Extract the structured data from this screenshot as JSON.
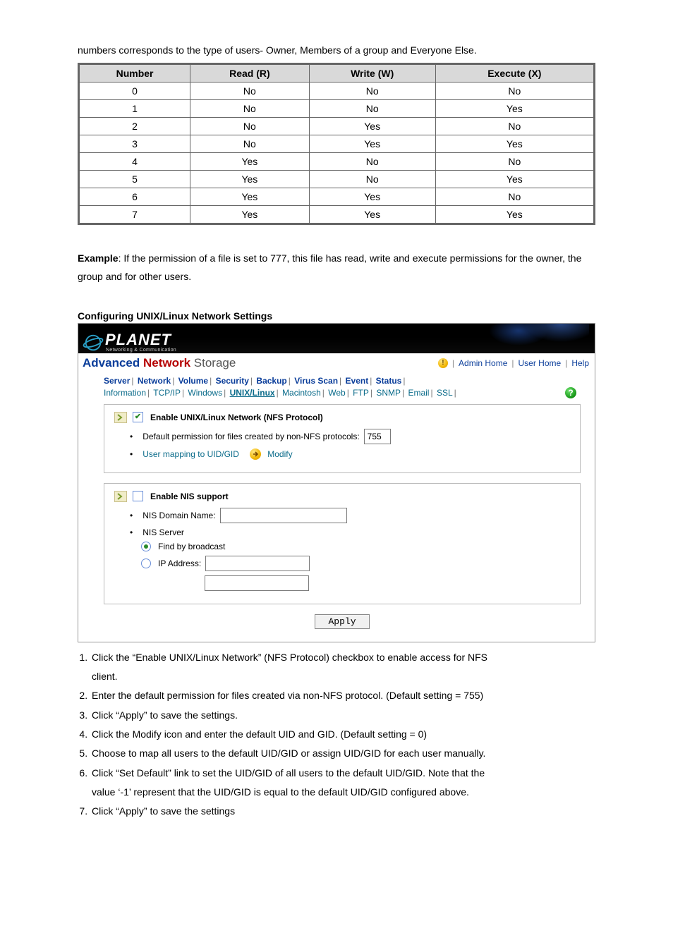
{
  "intro": "numbers corresponds to the type of users- Owner, Members of a group and Everyone Else.",
  "perm_table": {
    "headers": [
      "Number",
      "Read (R)",
      "Write (W)",
      "Execute (X)"
    ],
    "rows": [
      [
        "0",
        "No",
        "No",
        "No"
      ],
      [
        "1",
        "No",
        "No",
        "Yes"
      ],
      [
        "2",
        "No",
        "Yes",
        "No"
      ],
      [
        "3",
        "No",
        "Yes",
        "Yes"
      ],
      [
        "4",
        "Yes",
        "No",
        "No"
      ],
      [
        "5",
        "Yes",
        "No",
        "Yes"
      ],
      [
        "6",
        "Yes",
        "Yes",
        "No"
      ],
      [
        "7",
        "Yes",
        "Yes",
        "Yes"
      ]
    ]
  },
  "example_label": "Example",
  "example_text": ": If the permission of a file is set to 777, this file has read, write and execute permissions for the owner, the group and for other users.",
  "section_heading": "Configuring UNIX/Linux Network Settings",
  "shot": {
    "brand_main": "PLANET",
    "brand_sub": "Networking & Communication",
    "product_adv": "Advanced",
    "product_net": "Network",
    "product_rest": " Storage",
    "alert_glyph": "!",
    "crumbs": {
      "admin": "Admin Home",
      "user": "User Home",
      "help": "Help"
    },
    "tabs1": [
      "Server",
      "Network",
      "Volume",
      "Security",
      "Backup",
      "Virus Scan",
      "Event",
      "Status"
    ],
    "tabs2": [
      "Information",
      "TCP/IP",
      "Windows",
      "UNIX/Linux",
      "Macintosh",
      "Web",
      "FTP",
      "SNMP",
      "Email",
      "SSL"
    ],
    "tabs2_active_index": 3,
    "help_glyph": "?",
    "box1": {
      "title": "Enable UNIX/Linux Network (NFS Protocol)",
      "checked": true,
      "perm_label": "Default permission for files created by non-NFS protocols:",
      "perm_value": "755",
      "map_label": "User mapping to UID/GID",
      "modify_label": "Modify"
    },
    "box2": {
      "title": "Enable NIS support",
      "checked": false,
      "domain_label": "NIS Domain Name:",
      "domain_value": "",
      "server_label": "NIS Server",
      "broadcast_label": "Find by broadcast",
      "ip_label": "IP Address:",
      "ip_value": "",
      "ip_value2": ""
    },
    "apply_label": "Apply"
  },
  "steps": {
    "s1a": "Click the “Enable UNIX/Linux Network” (NFS Protocol) checkbox to enable access for NFS",
    "s1b": "client.",
    "s2": "Enter the default permission for files created via non-NFS protocol. (Default setting = 755)",
    "s3": "Click “Apply” to save the settings.",
    "s4": "Click the Modify icon and enter the default UID and GID. (Default setting = 0)",
    "s5": "Choose to map all users to the default UID/GID or assign UID/GID for each user manually.",
    "s6a": "Click “Set Default” link to set the UID/GID of all users to the default UID/GID. Note that the",
    "s6b": "value ‘-1’ represent that the UID/GID is equal to the default UID/GID configured above.",
    "s7": "Click “Apply” to save the settings"
  }
}
